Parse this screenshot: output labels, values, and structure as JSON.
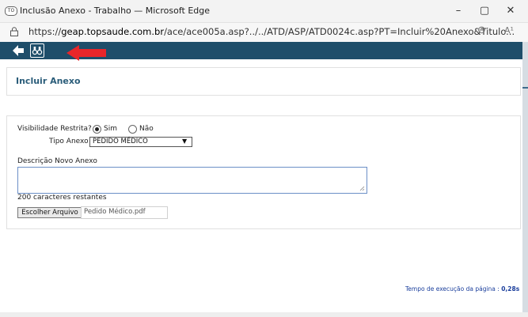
{
  "window": {
    "app_logo": "TO",
    "title": "Inclusão Anexo - Trabalho — Microsoft Edge",
    "minimize": "–",
    "maximize": "▢",
    "close": "✕"
  },
  "address_bar": {
    "url_prefix": "https://",
    "url_domain": "geap.topsaude.com.br",
    "url_path": "/ace/ace005a.asp?../../ATD/ASP/ATD0024c.asp?PT=Incluir%20Anexo&Titulo...",
    "zoom_icon": "⊖",
    "read_aloud_icon": "A¹"
  },
  "toolbar": {
    "accent_color": "#1f4e6a",
    "arrow_color": "#e8262a"
  },
  "page": {
    "heading": "Incluir Anexo"
  },
  "form": {
    "visibility_label": "Visibilidade Restrita?",
    "visibility_options": [
      "Sim",
      "Não"
    ],
    "visibility_selected": "Sim",
    "tipo_label": "Tipo Anexo",
    "tipo_value": "PEDIDO MÉDICO",
    "description_label": "Descrição Novo Anexo",
    "description_value": "",
    "chars_remaining": "200 caracteres restantes",
    "file_button": "Escolher Arquivo",
    "file_name": "Pedido Médico.pdf"
  },
  "footer": {
    "exec_label": "Tempo de execução da página :",
    "exec_value": "0,28s"
  }
}
